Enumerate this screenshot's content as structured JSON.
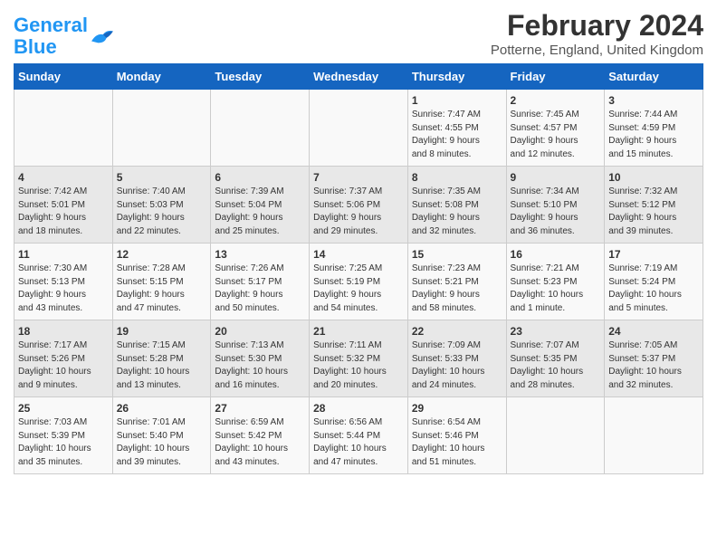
{
  "logo": {
    "text_general": "General",
    "text_blue": "Blue"
  },
  "title": "February 2024",
  "subtitle": "Potterne, England, United Kingdom",
  "days_of_week": [
    "Sunday",
    "Monday",
    "Tuesday",
    "Wednesday",
    "Thursday",
    "Friday",
    "Saturday"
  ],
  "weeks": [
    [
      {
        "day": "",
        "info": ""
      },
      {
        "day": "",
        "info": ""
      },
      {
        "day": "",
        "info": ""
      },
      {
        "day": "",
        "info": ""
      },
      {
        "day": "1",
        "info": "Sunrise: 7:47 AM\nSunset: 4:55 PM\nDaylight: 9 hours\nand 8 minutes."
      },
      {
        "day": "2",
        "info": "Sunrise: 7:45 AM\nSunset: 4:57 PM\nDaylight: 9 hours\nand 12 minutes."
      },
      {
        "day": "3",
        "info": "Sunrise: 7:44 AM\nSunset: 4:59 PM\nDaylight: 9 hours\nand 15 minutes."
      }
    ],
    [
      {
        "day": "4",
        "info": "Sunrise: 7:42 AM\nSunset: 5:01 PM\nDaylight: 9 hours\nand 18 minutes."
      },
      {
        "day": "5",
        "info": "Sunrise: 7:40 AM\nSunset: 5:03 PM\nDaylight: 9 hours\nand 22 minutes."
      },
      {
        "day": "6",
        "info": "Sunrise: 7:39 AM\nSunset: 5:04 PM\nDaylight: 9 hours\nand 25 minutes."
      },
      {
        "day": "7",
        "info": "Sunrise: 7:37 AM\nSunset: 5:06 PM\nDaylight: 9 hours\nand 29 minutes."
      },
      {
        "day": "8",
        "info": "Sunrise: 7:35 AM\nSunset: 5:08 PM\nDaylight: 9 hours\nand 32 minutes."
      },
      {
        "day": "9",
        "info": "Sunrise: 7:34 AM\nSunset: 5:10 PM\nDaylight: 9 hours\nand 36 minutes."
      },
      {
        "day": "10",
        "info": "Sunrise: 7:32 AM\nSunset: 5:12 PM\nDaylight: 9 hours\nand 39 minutes."
      }
    ],
    [
      {
        "day": "11",
        "info": "Sunrise: 7:30 AM\nSunset: 5:13 PM\nDaylight: 9 hours\nand 43 minutes."
      },
      {
        "day": "12",
        "info": "Sunrise: 7:28 AM\nSunset: 5:15 PM\nDaylight: 9 hours\nand 47 minutes."
      },
      {
        "day": "13",
        "info": "Sunrise: 7:26 AM\nSunset: 5:17 PM\nDaylight: 9 hours\nand 50 minutes."
      },
      {
        "day": "14",
        "info": "Sunrise: 7:25 AM\nSunset: 5:19 PM\nDaylight: 9 hours\nand 54 minutes."
      },
      {
        "day": "15",
        "info": "Sunrise: 7:23 AM\nSunset: 5:21 PM\nDaylight: 9 hours\nand 58 minutes."
      },
      {
        "day": "16",
        "info": "Sunrise: 7:21 AM\nSunset: 5:23 PM\nDaylight: 10 hours\nand 1 minute."
      },
      {
        "day": "17",
        "info": "Sunrise: 7:19 AM\nSunset: 5:24 PM\nDaylight: 10 hours\nand 5 minutes."
      }
    ],
    [
      {
        "day": "18",
        "info": "Sunrise: 7:17 AM\nSunset: 5:26 PM\nDaylight: 10 hours\nand 9 minutes."
      },
      {
        "day": "19",
        "info": "Sunrise: 7:15 AM\nSunset: 5:28 PM\nDaylight: 10 hours\nand 13 minutes."
      },
      {
        "day": "20",
        "info": "Sunrise: 7:13 AM\nSunset: 5:30 PM\nDaylight: 10 hours\nand 16 minutes."
      },
      {
        "day": "21",
        "info": "Sunrise: 7:11 AM\nSunset: 5:32 PM\nDaylight: 10 hours\nand 20 minutes."
      },
      {
        "day": "22",
        "info": "Sunrise: 7:09 AM\nSunset: 5:33 PM\nDaylight: 10 hours\nand 24 minutes."
      },
      {
        "day": "23",
        "info": "Sunrise: 7:07 AM\nSunset: 5:35 PM\nDaylight: 10 hours\nand 28 minutes."
      },
      {
        "day": "24",
        "info": "Sunrise: 7:05 AM\nSunset: 5:37 PM\nDaylight: 10 hours\nand 32 minutes."
      }
    ],
    [
      {
        "day": "25",
        "info": "Sunrise: 7:03 AM\nSunset: 5:39 PM\nDaylight: 10 hours\nand 35 minutes."
      },
      {
        "day": "26",
        "info": "Sunrise: 7:01 AM\nSunset: 5:40 PM\nDaylight: 10 hours\nand 39 minutes."
      },
      {
        "day": "27",
        "info": "Sunrise: 6:59 AM\nSunset: 5:42 PM\nDaylight: 10 hours\nand 43 minutes."
      },
      {
        "day": "28",
        "info": "Sunrise: 6:56 AM\nSunset: 5:44 PM\nDaylight: 10 hours\nand 47 minutes."
      },
      {
        "day": "29",
        "info": "Sunrise: 6:54 AM\nSunset: 5:46 PM\nDaylight: 10 hours\nand 51 minutes."
      },
      {
        "day": "",
        "info": ""
      },
      {
        "day": "",
        "info": ""
      }
    ]
  ]
}
